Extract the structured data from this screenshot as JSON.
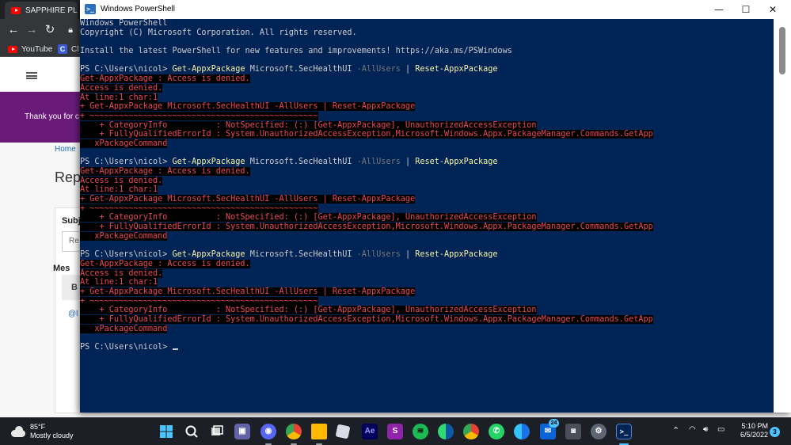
{
  "browser": {
    "tab_title": "SAPPHIRE PL",
    "bookmarks": [
      "YouTube",
      "Cl"
    ],
    "banner_text": "Thank you for c",
    "breadcrumb": "Home",
    "page_heading": "Rep",
    "subject_label": "Subj",
    "subject_value": "Re",
    "message_label": "Mes",
    "bold_button": "B",
    "mention_text": "@l"
  },
  "powershell": {
    "window_title": "Windows PowerShell",
    "icon_glyph": ">_",
    "controls": {
      "minimize": "—",
      "maximize": "☐",
      "close": "✕"
    },
    "header_lines": [
      "Windows PowerShell",
      "Copyright (C) Microsoft Corporation. All rights reserved.",
      "",
      "Install the latest PowerShell for new features and improvements! https://aka.ms/PSWindows",
      ""
    ],
    "prompt": "PS C:\\Users\\nicol> ",
    "command": {
      "cmdlet": "Get-AppxPackage",
      "arg": " Microsoft.SecHealthUI ",
      "param": "-AllUsers",
      "pipe": " | ",
      "cmdlet2": "Reset-AppxPackage"
    },
    "error_lines": [
      "Get-AppxPackage : Access is denied.",
      "Access is denied.",
      "At line:1 char:1",
      "+ Get-AppxPackage Microsoft.SecHealthUI -AllUsers | Reset-AppxPackage",
      "+ ~~~~~~~~~~~~~~~~~~~~~~~~~~~~~~~~~~~~~~~~~~~~~~~",
      "    + CategoryInfo          : NotSpecified: (:) [Get-AppxPackage], UnauthorizedAccessException",
      "    + FullyQualifiedErrorId : System.UnauthorizedAccessException,Microsoft.Windows.Appx.PackageManager.Commands.GetApp",
      "   xPackageCommand"
    ],
    "repeat_count": 3,
    "final_prompt": "PS C:\\Users\\nicol> "
  },
  "taskbar": {
    "temperature": "85°F",
    "weather_desc": "Mostly cloudy",
    "time": "5:10 PM",
    "date": "6/5/2022",
    "notification_count": "3",
    "mail_badge": "24",
    "adobe_label": "Ae"
  },
  "colors": {
    "ps_background": "#012456",
    "ps_error": "#e74856",
    "ps_cmdlet": "#f9f1a5",
    "ps_param": "#767676",
    "banner": "#6a1b7a"
  }
}
